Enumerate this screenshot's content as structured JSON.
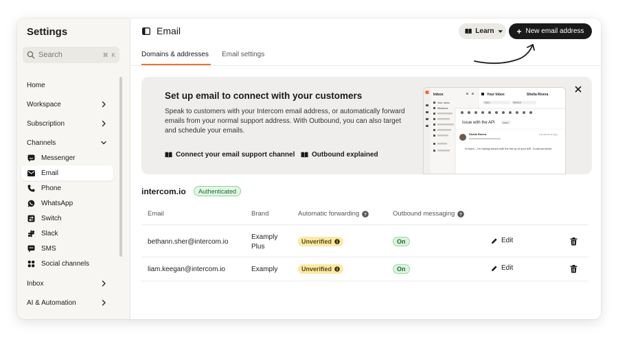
{
  "sidebar": {
    "title": "Settings",
    "search": {
      "placeholder": "Search",
      "shortcut_cmd": "⌘",
      "shortcut_key": "K"
    },
    "items": [
      {
        "label": "Home"
      },
      {
        "label": "Workspace"
      },
      {
        "label": "Subscription"
      },
      {
        "label": "Channels"
      },
      {
        "label": "Messenger"
      },
      {
        "label": "Email"
      },
      {
        "label": "Phone"
      },
      {
        "label": "WhatsApp"
      },
      {
        "label": "Switch"
      },
      {
        "label": "Slack"
      },
      {
        "label": "SMS"
      },
      {
        "label": "Social channels"
      },
      {
        "label": "Inbox"
      },
      {
        "label": "AI & Automation"
      }
    ]
  },
  "header": {
    "title": "Email",
    "learn_label": "Learn",
    "new_email_label": "New email address"
  },
  "tabs": [
    {
      "label": "Domains & addresses"
    },
    {
      "label": "Email settings"
    }
  ],
  "banner": {
    "title": "Set up email to connect with your customers",
    "description": "Speak to customers with your Intercom email address, or automatically forward emails from your normal support address. With Outbound, you can also target and schedule your emails.",
    "link1": "Connect your email support channel",
    "link2": "Outbound explained",
    "preview": {
      "inbox": "Inbox",
      "your_inbox": "Your Inbox",
      "agent_name": "Sheila Rivera",
      "your_inbox_item": "Your Inbox",
      "mentions": "Mentions",
      "open_filter": "Open",
      "newest_filter": "Newest",
      "subject": "Issue with the API",
      "inbox_tag": "Inbox",
      "sender": "Sheila Rivera",
      "time": "5:14 AM (8 min ago)",
      "body": "Hi team – I'm having issues with the set up of your API. Could someone"
    }
  },
  "domain": {
    "name": "intercom.io",
    "status": "Authenticated"
  },
  "table": {
    "headers": {
      "email": "Email",
      "brand": "Brand",
      "forwarding": "Automatic forwarding",
      "outbound": "Outbound messaging"
    },
    "rows": [
      {
        "email": "bethann.sher@intercom.io",
        "brand_line1": "Examply",
        "brand_line2": "Plus",
        "forwarding": "Unverified",
        "outbound": "On",
        "action": "Edit"
      },
      {
        "email": "liam.keegan@intercom.io",
        "brand_line1": "Examply",
        "brand_line2": "",
        "forwarding": "Unverified",
        "outbound": "On",
        "action": "Edit"
      }
    ]
  },
  "colors": {
    "accent_tab": "#f26b38",
    "primary_button": "#1a1a1a",
    "unverified_bg": "#fbe9a9",
    "on_bg": "#dcf3df",
    "authenticated_bg": "#e4f6e6"
  }
}
